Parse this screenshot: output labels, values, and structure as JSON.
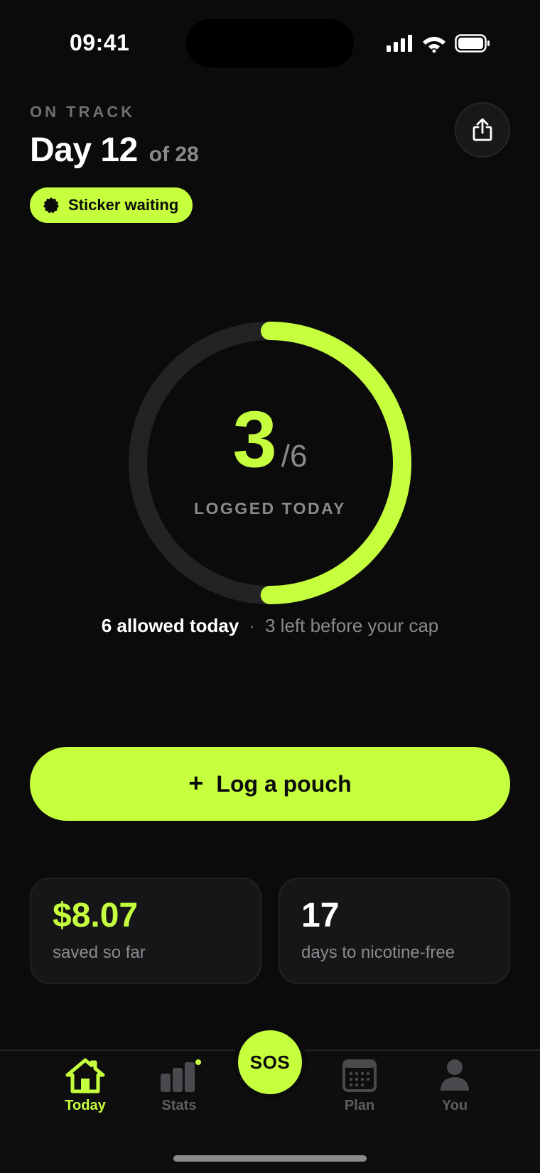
{
  "status_bar": {
    "time": "09:41",
    "icons": [
      "signal-icon",
      "wifi-icon",
      "battery-icon"
    ]
  },
  "header": {
    "eyebrow": "ON TRACK",
    "day_title": "Day 12",
    "day_of": "of 28",
    "share_icon": "share-icon",
    "sticker_label": "Sticker waiting"
  },
  "progress": {
    "logged": "3",
    "total": "/6",
    "label": "LOGGED TODAY",
    "fraction": 0.5
  },
  "allowance": {
    "allowed": "6 allowed today",
    "separator": "·",
    "remaining": "3 left before your cap"
  },
  "log_button": {
    "plus": "+",
    "label": "Log a pouch"
  },
  "stats": {
    "saved_value": "$8.07",
    "saved_label": "saved so far",
    "days_value": "17",
    "days_label": "days to nicotine-free"
  },
  "tabbar": {
    "today": "Today",
    "stats": "Stats",
    "sos": "SOS",
    "plan": "Plan",
    "you": "You"
  },
  "colors": {
    "accent": "#c6ff3d",
    "background": "#0b0b0c",
    "muted": "#8a8a8e",
    "track": "#232326"
  }
}
